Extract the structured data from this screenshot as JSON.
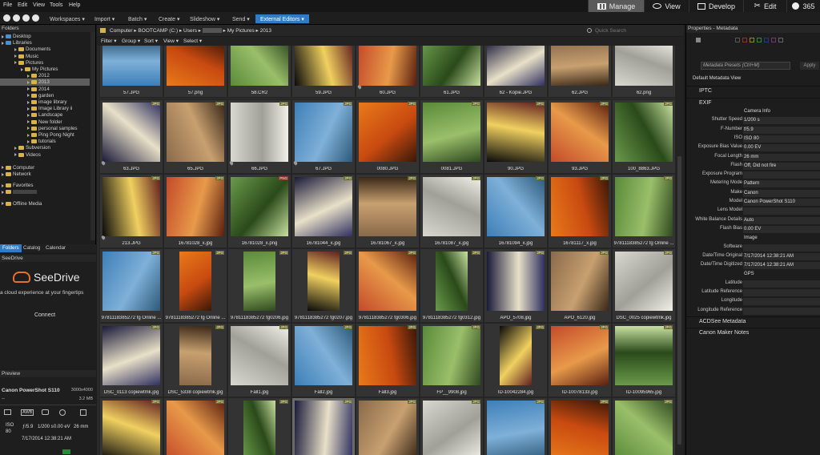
{
  "menubar": {
    "items": [
      "File",
      "Edit",
      "View",
      "Tools",
      "Help"
    ]
  },
  "modes": [
    {
      "label": "Manage",
      "icon": "grid-icon",
      "active": true
    },
    {
      "label": "View",
      "icon": "eye-icon",
      "active": false
    },
    {
      "label": "Develop",
      "icon": "develop-icon",
      "active": false
    },
    {
      "label": "Edit",
      "icon": "edit-tools-icon",
      "active": false
    },
    {
      "label": "365",
      "icon": "cloud-365-icon",
      "active": false
    }
  ],
  "toolbar": {
    "items": [
      "Workspaces ▾",
      "Import ▾",
      "Batch ▾",
      "Create ▾",
      "Slideshow ▾",
      "Send ▾"
    ],
    "active_item": "External Editors ▾"
  },
  "folders": {
    "title": "Folders",
    "rows": [
      "Desktop",
      "Libraries",
      "Documents",
      "Music",
      "Pictures",
      "My Pictures",
      "2012",
      "2013",
      "2014",
      "garden",
      "image library",
      "Image Library ii",
      "Landscape",
      "New folder",
      "personal samples",
      "Ping Pong Night",
      "tutorials",
      "Subversion",
      "Videos",
      "Computer",
      "Network",
      "Favorites",
      "",
      "Offline Media"
    ],
    "selected": "2013",
    "tabs": [
      "Folders",
      "Catalog",
      "Calendar"
    ]
  },
  "seedrive": {
    "title": "SeeDrive",
    "brand": "SeeDrive",
    "tagline": "a cloud experience at your fingertips",
    "button": "Connect"
  },
  "preview": {
    "title": "Preview",
    "camera": "Canon PowerShot S110",
    "dims": "3000x4000",
    "size": "3.2 MB",
    "dash": "--",
    "awb": "AWB",
    "iso_label": "ISO",
    "iso": "80",
    "aperture": "ƒ/5.9",
    "shutter": "1/200 s",
    "ev": "0.00 eV",
    "focal": "26 mm",
    "datetime": "7/17/2014 12:38:21 AM"
  },
  "path": {
    "segments": [
      "Computer",
      "BOOTCAMP (C:)",
      "Users",
      "",
      "My Pictures",
      "2013"
    ],
    "search_placeholder": "Quick Search"
  },
  "filterbar": {
    "items": [
      "Filter ▾",
      "Group ▾",
      "Sort ▾",
      "View ▾",
      "Select ▾"
    ]
  },
  "grid": {
    "rows": [
      [
        [
          "57.JPG",
          ""
        ],
        [
          "57.png",
          ""
        ],
        [
          "58.CR2",
          ""
        ],
        [
          "59.JPG",
          ""
        ],
        [
          "60.JPG",
          ""
        ],
        [
          "61.JPG",
          ""
        ],
        [
          "62 - Kopie.JPG",
          ""
        ],
        [
          "62.JPG",
          ""
        ],
        [
          "62.png",
          ""
        ]
      ],
      [
        [
          "63.JPG",
          "JPG"
        ],
        [
          "65.JPG",
          "JPG"
        ],
        [
          "66.JPG",
          "JPG"
        ],
        [
          "67.JPG",
          "JPG"
        ],
        [
          "0080.JPG",
          "JPG"
        ],
        [
          "0081.JPG",
          "JPG"
        ],
        [
          "90.JPG",
          "JPG"
        ],
        [
          "93.JPG",
          "JPG"
        ],
        [
          "100_8863.JPG",
          "JPG"
        ]
      ],
      [
        [
          "213.JPG",
          "JPG"
        ],
        [
          "16781028_x.jpg",
          "JPG"
        ],
        [
          "16781028_x.png",
          "PNG"
        ],
        [
          "16781044_x.jpg",
          "JPG"
        ],
        [
          "16781067_x.jpg",
          "JPG"
        ],
        [
          "16781087_x.jpg",
          "JPG"
        ],
        [
          "16781094_x.jpg",
          "JPG"
        ],
        [
          "16781117_x.jpg",
          "JPG"
        ],
        [
          "9781118385272 fg Online ...",
          "JPG"
        ]
      ],
      [
        [
          "9781118385272 fg Online ...",
          "JPG"
        ],
        [
          "9781118385272 fg Online ...",
          "JPG"
        ],
        [
          "9781118385272 fg0206.jpg",
          "JPG"
        ],
        [
          "9781118385272 fg0207.jpg",
          "JPG"
        ],
        [
          "9781118385272 fg0306.jpg",
          "JPG"
        ],
        [
          "9781118385272 fg0312.jpg",
          "JPG"
        ],
        [
          "APO_5708.jpg",
          "JPG"
        ],
        [
          "APO_6120.jpg",
          "JPG"
        ],
        [
          "DSC_0025 copiewtmk.jpg",
          "JPG"
        ]
      ],
      [
        [
          "DSC_0113 copiewtmk.jpg",
          "JPG"
        ],
        [
          "DSC_5338 copiewtmk.jpg",
          "JPG"
        ],
        [
          "Fall1.jpg",
          "JPG"
        ],
        [
          "Fall2.jpg",
          "JPG"
        ],
        [
          "Fall3.jpg",
          "JPG"
        ],
        [
          "FP__9908.jpg",
          "JPG"
        ],
        [
          "ID-10042284.jpg",
          "JPG"
        ],
        [
          "ID-10078133.jpg",
          "JPG"
        ],
        [
          "ID-10095965.jpg",
          "JPG"
        ]
      ],
      [
        [
          "",
          "JPG"
        ],
        [
          "",
          "JPG"
        ],
        [
          "",
          "JPG"
        ],
        [
          "",
          "JPG"
        ],
        [
          "",
          "JPG"
        ],
        [
          "",
          "JPG"
        ],
        [
          "",
          "JPG"
        ],
        [
          "",
          "JPG"
        ],
        [
          "",
          "JPG"
        ]
      ]
    ]
  },
  "properties": {
    "title": "Properties - Metadata",
    "preset_placeholder": "Metadata Presets (Ctrl+M)",
    "apply": "Apply",
    "default_view": "Default Metadata View",
    "sections": {
      "iptc": "IPTC",
      "exif": "EXIF",
      "acdsee": "ACDSee Metadata",
      "maker": "Canon Maker Notes"
    },
    "exif_rows": [
      [
        "",
        "Camera Info"
      ],
      [
        "Shutter Speed",
        "1/200 s"
      ],
      [
        "F-Number",
        "f/5.9"
      ],
      [
        "ISO",
        "ISO 80"
      ],
      [
        "Exposure Bias Value",
        "0.00 EV"
      ],
      [
        "Focal Length",
        "26 mm"
      ],
      [
        "Flash",
        "Off, Did not fire"
      ],
      [
        "Exposure Program",
        ""
      ],
      [
        "Metering Mode",
        "Pattern"
      ],
      [
        "Make",
        "Canon"
      ],
      [
        "Model",
        "Canon PowerShot S110"
      ],
      [
        "Lens Model",
        ""
      ],
      [
        "White Balance Details",
        "Auto"
      ],
      [
        "Flash Bias",
        "0.00 EV"
      ],
      [
        "",
        "Image"
      ],
      [
        "Software",
        ""
      ],
      [
        "Date/Time Original",
        "7/17/2014 12:38:21 AM"
      ],
      [
        "Date/Time Digitized",
        "7/17/2014 12:38:21 AM"
      ],
      [
        "",
        "GPS"
      ],
      [
        "Latitude",
        ""
      ],
      [
        "Latitude Reference",
        ""
      ],
      [
        "Longitude",
        ""
      ],
      [
        "Longitude Reference",
        ""
      ]
    ]
  },
  "colors": {
    "accent": "#2e7bc6",
    "seedrive": "#e8702a"
  }
}
